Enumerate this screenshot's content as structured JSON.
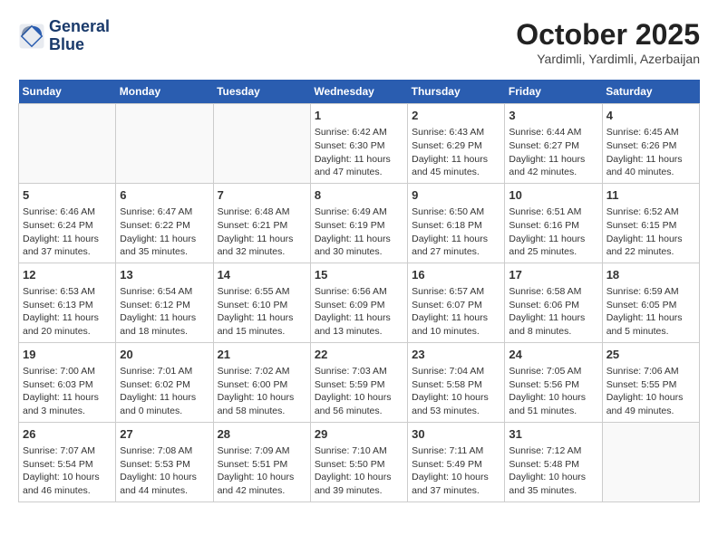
{
  "header": {
    "logo_line1": "General",
    "logo_line2": "Blue",
    "month": "October 2025",
    "location": "Yardimli, Yardimli, Azerbaijan"
  },
  "weekdays": [
    "Sunday",
    "Monday",
    "Tuesday",
    "Wednesday",
    "Thursday",
    "Friday",
    "Saturday"
  ],
  "weeks": [
    [
      {
        "day": "",
        "info": ""
      },
      {
        "day": "",
        "info": ""
      },
      {
        "day": "",
        "info": ""
      },
      {
        "day": "1",
        "info": "Sunrise: 6:42 AM\nSunset: 6:30 PM\nDaylight: 11 hours\nand 47 minutes."
      },
      {
        "day": "2",
        "info": "Sunrise: 6:43 AM\nSunset: 6:29 PM\nDaylight: 11 hours\nand 45 minutes."
      },
      {
        "day": "3",
        "info": "Sunrise: 6:44 AM\nSunset: 6:27 PM\nDaylight: 11 hours\nand 42 minutes."
      },
      {
        "day": "4",
        "info": "Sunrise: 6:45 AM\nSunset: 6:26 PM\nDaylight: 11 hours\nand 40 minutes."
      }
    ],
    [
      {
        "day": "5",
        "info": "Sunrise: 6:46 AM\nSunset: 6:24 PM\nDaylight: 11 hours\nand 37 minutes."
      },
      {
        "day": "6",
        "info": "Sunrise: 6:47 AM\nSunset: 6:22 PM\nDaylight: 11 hours\nand 35 minutes."
      },
      {
        "day": "7",
        "info": "Sunrise: 6:48 AM\nSunset: 6:21 PM\nDaylight: 11 hours\nand 32 minutes."
      },
      {
        "day": "8",
        "info": "Sunrise: 6:49 AM\nSunset: 6:19 PM\nDaylight: 11 hours\nand 30 minutes."
      },
      {
        "day": "9",
        "info": "Sunrise: 6:50 AM\nSunset: 6:18 PM\nDaylight: 11 hours\nand 27 minutes."
      },
      {
        "day": "10",
        "info": "Sunrise: 6:51 AM\nSunset: 6:16 PM\nDaylight: 11 hours\nand 25 minutes."
      },
      {
        "day": "11",
        "info": "Sunrise: 6:52 AM\nSunset: 6:15 PM\nDaylight: 11 hours\nand 22 minutes."
      }
    ],
    [
      {
        "day": "12",
        "info": "Sunrise: 6:53 AM\nSunset: 6:13 PM\nDaylight: 11 hours\nand 20 minutes."
      },
      {
        "day": "13",
        "info": "Sunrise: 6:54 AM\nSunset: 6:12 PM\nDaylight: 11 hours\nand 18 minutes."
      },
      {
        "day": "14",
        "info": "Sunrise: 6:55 AM\nSunset: 6:10 PM\nDaylight: 11 hours\nand 15 minutes."
      },
      {
        "day": "15",
        "info": "Sunrise: 6:56 AM\nSunset: 6:09 PM\nDaylight: 11 hours\nand 13 minutes."
      },
      {
        "day": "16",
        "info": "Sunrise: 6:57 AM\nSunset: 6:07 PM\nDaylight: 11 hours\nand 10 minutes."
      },
      {
        "day": "17",
        "info": "Sunrise: 6:58 AM\nSunset: 6:06 PM\nDaylight: 11 hours\nand 8 minutes."
      },
      {
        "day": "18",
        "info": "Sunrise: 6:59 AM\nSunset: 6:05 PM\nDaylight: 11 hours\nand 5 minutes."
      }
    ],
    [
      {
        "day": "19",
        "info": "Sunrise: 7:00 AM\nSunset: 6:03 PM\nDaylight: 11 hours\nand 3 minutes."
      },
      {
        "day": "20",
        "info": "Sunrise: 7:01 AM\nSunset: 6:02 PM\nDaylight: 11 hours\nand 0 minutes."
      },
      {
        "day": "21",
        "info": "Sunrise: 7:02 AM\nSunset: 6:00 PM\nDaylight: 10 hours\nand 58 minutes."
      },
      {
        "day": "22",
        "info": "Sunrise: 7:03 AM\nSunset: 5:59 PM\nDaylight: 10 hours\nand 56 minutes."
      },
      {
        "day": "23",
        "info": "Sunrise: 7:04 AM\nSunset: 5:58 PM\nDaylight: 10 hours\nand 53 minutes."
      },
      {
        "day": "24",
        "info": "Sunrise: 7:05 AM\nSunset: 5:56 PM\nDaylight: 10 hours\nand 51 minutes."
      },
      {
        "day": "25",
        "info": "Sunrise: 7:06 AM\nSunset: 5:55 PM\nDaylight: 10 hours\nand 49 minutes."
      }
    ],
    [
      {
        "day": "26",
        "info": "Sunrise: 7:07 AM\nSunset: 5:54 PM\nDaylight: 10 hours\nand 46 minutes."
      },
      {
        "day": "27",
        "info": "Sunrise: 7:08 AM\nSunset: 5:53 PM\nDaylight: 10 hours\nand 44 minutes."
      },
      {
        "day": "28",
        "info": "Sunrise: 7:09 AM\nSunset: 5:51 PM\nDaylight: 10 hours\nand 42 minutes."
      },
      {
        "day": "29",
        "info": "Sunrise: 7:10 AM\nSunset: 5:50 PM\nDaylight: 10 hours\nand 39 minutes."
      },
      {
        "day": "30",
        "info": "Sunrise: 7:11 AM\nSunset: 5:49 PM\nDaylight: 10 hours\nand 37 minutes."
      },
      {
        "day": "31",
        "info": "Sunrise: 7:12 AM\nSunset: 5:48 PM\nDaylight: 10 hours\nand 35 minutes."
      },
      {
        "day": "",
        "info": ""
      }
    ]
  ]
}
